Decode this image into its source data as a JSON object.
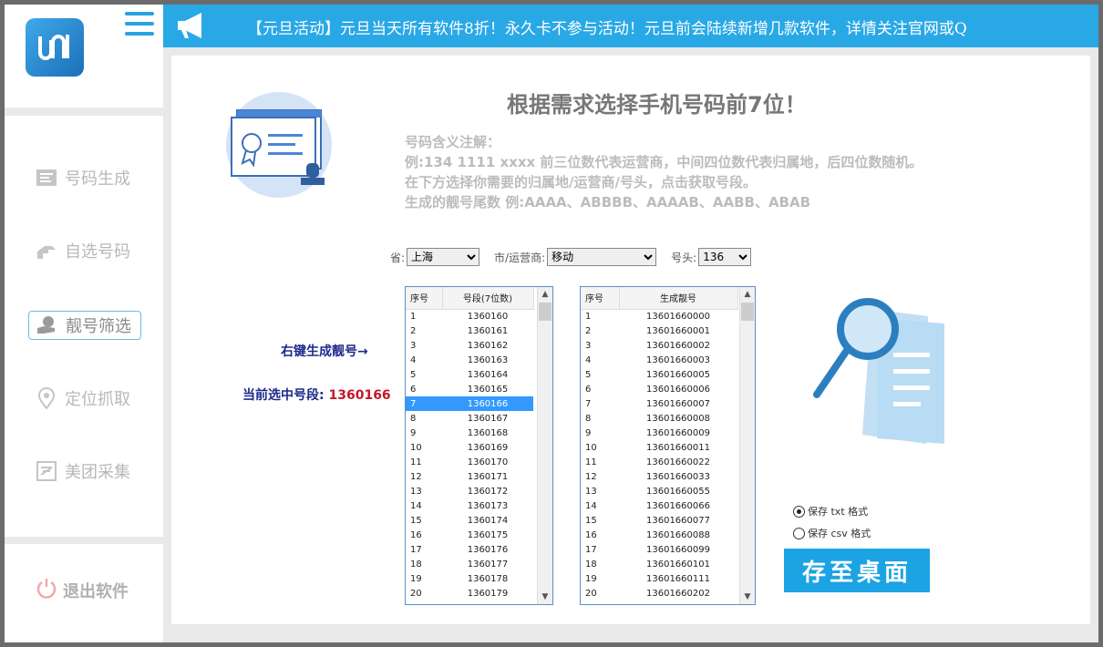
{
  "sidebar": {
    "items": [
      {
        "label": "号码生成",
        "icon": "message-icon"
      },
      {
        "label": "自选号码",
        "icon": "hand-pick-icon"
      },
      {
        "label": "靓号筛选",
        "icon": "hand-coin-icon"
      },
      {
        "label": "定位抓取",
        "icon": "location-pin-icon"
      },
      {
        "label": "美团采集",
        "icon": "collect-icon"
      }
    ],
    "active_index": 2,
    "exit_label": "退出软件"
  },
  "topbar": {
    "marquee": "【元旦活动】元旦当天所有软件8折！永久卡不参与活动！元旦前会陆续新增几款软件，详情关注官网或Q"
  },
  "main": {
    "headline": "根据需求选择手机号码前7位！",
    "notes": [
      "号码含义注解：",
      "例:134 1111 xxxx  前三位数代表运营商，中间四位数代表归属地，后四位数随机。",
      "在下方选择你需要的归属地/运营商/号头，点击获取号段。",
      "生成的靓号尾数 例:AAAA、ABBBB、AAAAB、AABB、ABAB"
    ],
    "filters": {
      "province_label": "省:",
      "province_value": "上海",
      "city_label": "市/运营商:",
      "city_value": "移动",
      "prefix_label": "号头:",
      "prefix_value": "136"
    },
    "hint": "右键生成靓号→",
    "current_label": "当前选中号段:",
    "current_value": "1360166",
    "segments": {
      "headers": [
        "序号",
        "号段(7位数)"
      ],
      "selected_index": 6,
      "rows": [
        [
          "1",
          "1360160"
        ],
        [
          "2",
          "1360161"
        ],
        [
          "3",
          "1360162"
        ],
        [
          "4",
          "1360163"
        ],
        [
          "5",
          "1360164"
        ],
        [
          "6",
          "1360165"
        ],
        [
          "7",
          "1360166"
        ],
        [
          "8",
          "1360167"
        ],
        [
          "9",
          "1360168"
        ],
        [
          "10",
          "1360169"
        ],
        [
          "11",
          "1360170"
        ],
        [
          "12",
          "1360171"
        ],
        [
          "13",
          "1360172"
        ],
        [
          "14",
          "1360173"
        ],
        [
          "15",
          "1360174"
        ],
        [
          "16",
          "1360175"
        ],
        [
          "17",
          "1360176"
        ],
        [
          "18",
          "1360177"
        ],
        [
          "19",
          "1360178"
        ],
        [
          "20",
          "1360179"
        ]
      ]
    },
    "numbers": {
      "headers": [
        "序号",
        "生成靓号"
      ],
      "rows": [
        [
          "1",
          "13601660000"
        ],
        [
          "2",
          "13601660001"
        ],
        [
          "3",
          "13601660002"
        ],
        [
          "4",
          "13601660003"
        ],
        [
          "5",
          "13601660005"
        ],
        [
          "6",
          "13601660006"
        ],
        [
          "7",
          "13601660007"
        ],
        [
          "8",
          "13601660008"
        ],
        [
          "9",
          "13601660009"
        ],
        [
          "10",
          "13601660011"
        ],
        [
          "11",
          "13601660022"
        ],
        [
          "12",
          "13601660033"
        ],
        [
          "13",
          "13601660055"
        ],
        [
          "14",
          "13601660066"
        ],
        [
          "15",
          "13601660077"
        ],
        [
          "16",
          "13601660088"
        ],
        [
          "17",
          "13601660099"
        ],
        [
          "18",
          "13601660101"
        ],
        [
          "19",
          "13601660111"
        ],
        [
          "20",
          "13601660202"
        ]
      ]
    },
    "save_options": [
      {
        "label": "保存 txt 格式",
        "checked": true
      },
      {
        "label": "保存 csv 格式",
        "checked": false
      }
    ],
    "save_button": "存至桌面"
  },
  "colors": {
    "accent": "#29a8e6",
    "selection": "#3399ff",
    "value_red": "#c0182b",
    "label_blue": "#1c2a8a"
  }
}
